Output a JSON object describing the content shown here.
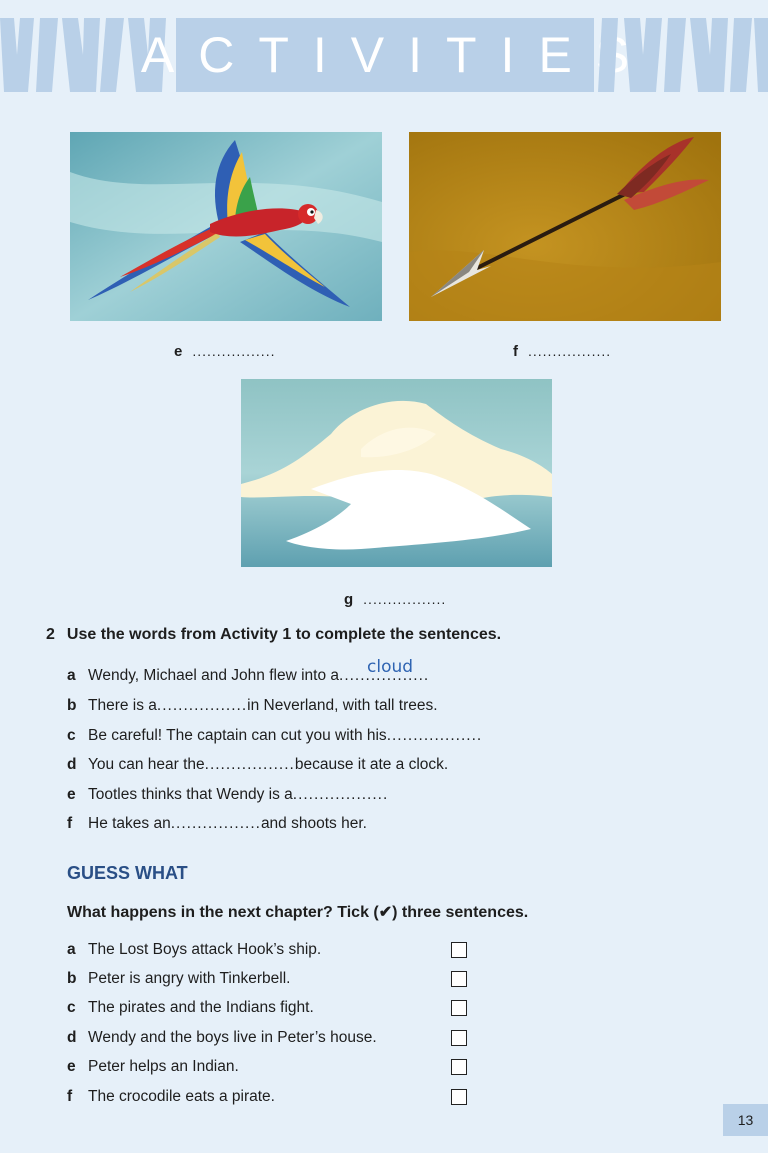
{
  "banner": {
    "title": "ACTIVITIES"
  },
  "pictures": [
    {
      "letter": "e",
      "blank": ".................",
      "subject": "parrot"
    },
    {
      "letter": "f",
      "blank": ".................",
      "subject": "arrow"
    },
    {
      "letter": "g",
      "blank": ".................",
      "subject": "cloud"
    }
  ],
  "exercise2": {
    "number": "2",
    "instruction": "Use the words from Activity 1 to complete the sentences.",
    "items": [
      {
        "letter": "a",
        "before": "Wendy, Michael and John flew into a",
        "blank": "................",
        "after": " .",
        "answer": "cloud"
      },
      {
        "letter": "b",
        "before": "There is a",
        "blank": ".................",
        "after": "in Neverland, with tall trees."
      },
      {
        "letter": "c",
        "before": "Be careful! The captain can cut you with his",
        "blank": ".................",
        "after": " ."
      },
      {
        "letter": "d",
        "before": "You can hear the",
        "blank": ".................",
        "after": "because it ate a clock."
      },
      {
        "letter": "e",
        "before": "Tootles thinks that Wendy is a",
        "blank": ".................",
        "after": " ."
      },
      {
        "letter": "f",
        "before": "He takes an",
        "blank": ".................",
        "after": "and shoots her."
      }
    ]
  },
  "guess": {
    "heading": "GUESS WHAT",
    "instruction": "What happens in the next chapter? Tick (✔) three sentences.",
    "items": [
      {
        "letter": "a",
        "text": "The Lost Boys attack Hook’s ship.",
        "checked": false
      },
      {
        "letter": "b",
        "text": "Peter is angry with Tinkerbell.",
        "checked": false
      },
      {
        "letter": "c",
        "text": "The pirates and the Indians fight.",
        "checked": false
      },
      {
        "letter": "d",
        "text": "Wendy and the boys live in Peter’s house.",
        "checked": false
      },
      {
        "letter": "e",
        "text": "Peter helps an Indian.",
        "checked": false
      },
      {
        "letter": "f",
        "text": "The crocodile eats a pirate.",
        "checked": false
      }
    ]
  },
  "page_number": "13",
  "colors": {
    "background": "#e6f0f9",
    "banner": "#b9d0e8",
    "heading_blue": "#2a4f86",
    "handwriting": "#2f64b2"
  }
}
